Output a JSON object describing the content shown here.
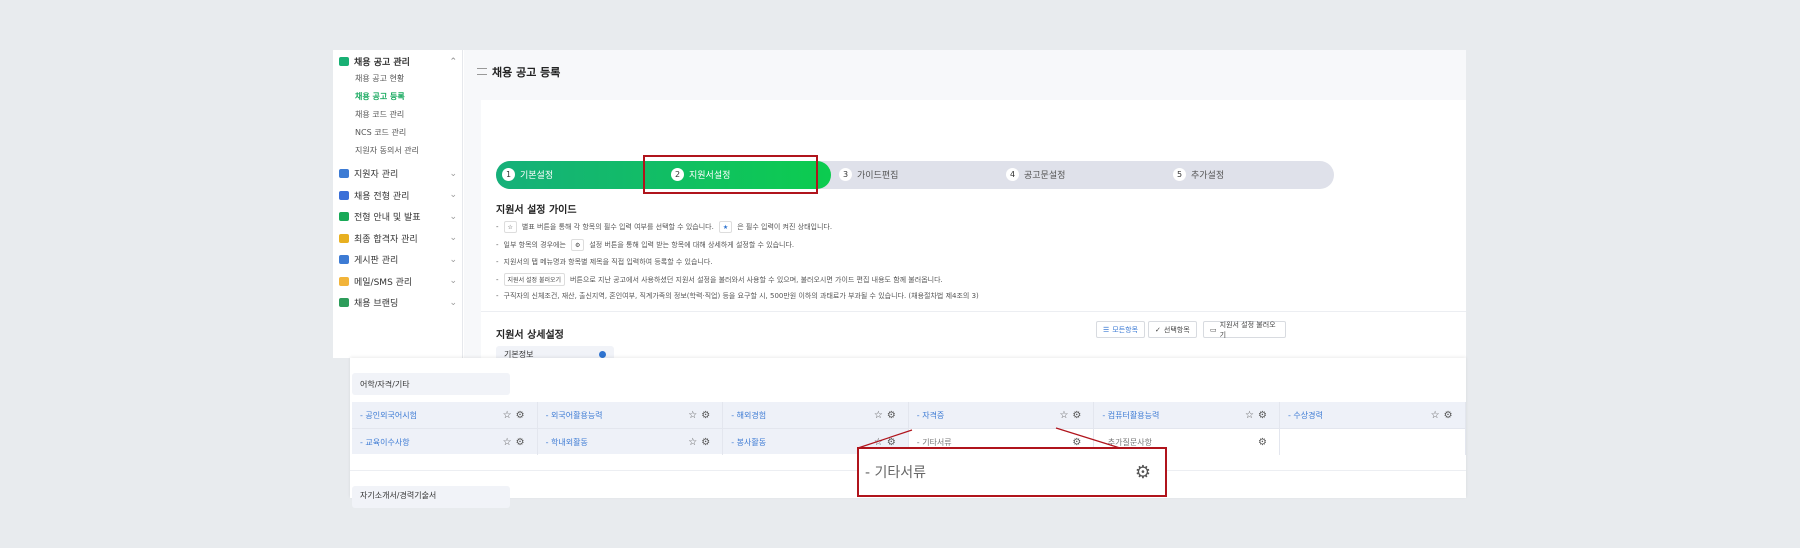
{
  "sidebar": {
    "main_group": {
      "label": "채용 공고 관리",
      "subitems": [
        "채용 공고 현황",
        "채용 공고 등록",
        "채용 코드 관리",
        "NCS 코드 관리",
        "지원자 동의서 관리"
      ]
    },
    "items": [
      {
        "label": "지원자 관리",
        "color": "#3d7bd4"
      },
      {
        "label": "채용 전형 관리",
        "color": "#3a6fd8"
      },
      {
        "label": "전형 안내 및 발표",
        "color": "#18a957"
      },
      {
        "label": "최종 합격자 관리",
        "color": "#e8b020"
      },
      {
        "label": "게시판 관리",
        "color": "#3d7bd4"
      },
      {
        "label": "메일/SMS 관리",
        "color": "#f2b43a"
      },
      {
        "label": "채용 브랜딩",
        "color": "#2d9c5a"
      }
    ]
  },
  "header": {
    "title": "채용 공고 등록"
  },
  "steps": [
    {
      "num": "1",
      "label": "기본설정"
    },
    {
      "num": "2",
      "label": "지원서설정"
    },
    {
      "num": "3",
      "label": "가이드편집"
    },
    {
      "num": "4",
      "label": "공고문설정"
    },
    {
      "num": "5",
      "label": "추가설정"
    }
  ],
  "guide": {
    "title": "지원서 설정 가이드",
    "b1a": "별표 버튼을 통해 각 항목의 필수 입력 여부를 선택할 수 있습니다.",
    "b1b": "은 필수 입력이 켜진 상태입니다.",
    "b2a": "일부 항목의 경우에는",
    "b2b": "설정 버튼을 통해 입력 받는 항목에 대해 상세하게 설정할 수 있습니다.",
    "b3": "지원서의 탭 메뉴명과 항목별 제목을 직접 입력하여 등록할 수 있습니다.",
    "b4chip": "지원서 설정 불러오기",
    "b4": "버튼으로 지난 공고에서 사용하셨던 지원서 설정을 불러와서 사용할 수 있으며, 불러오시면 가이드 편집 내용도 함께 불러옵니다.",
    "b5": "구직자의 신체조건, 재산, 출신지역, 혼인여부, 직계가족의 정보(학력·직업) 등을 요구할 시, 500만원 이하의 과태료가 부과될 수 있습니다. (채용절차법 제4조의 3)"
  },
  "detail": {
    "title": "지원서 상세설정",
    "btn_all": "모든항목",
    "btn_selected": "선택항목",
    "btn_load": "지원서 설정 불러오기",
    "cat_basic": "기본정보"
  },
  "bottom": {
    "category": "어학/자격/기타",
    "row1": [
      "- 공인외국어시험",
      "- 외국어활용능력",
      "- 해외경험",
      "- 자격증",
      "- 컴퓨터활용능력",
      "- 수상경력"
    ],
    "row2": [
      "- 교육이수사항",
      "- 학내외활동",
      "- 봉사활동",
      "- 기타서류",
      "- 추가질문사항"
    ],
    "next_category": "자기소개서/경력기술서"
  },
  "callout": {
    "label": "- 기타서류"
  },
  "colors": {
    "accent": "#0ccc4f",
    "highlight": "#b0141c",
    "link": "#3d7bd4"
  }
}
